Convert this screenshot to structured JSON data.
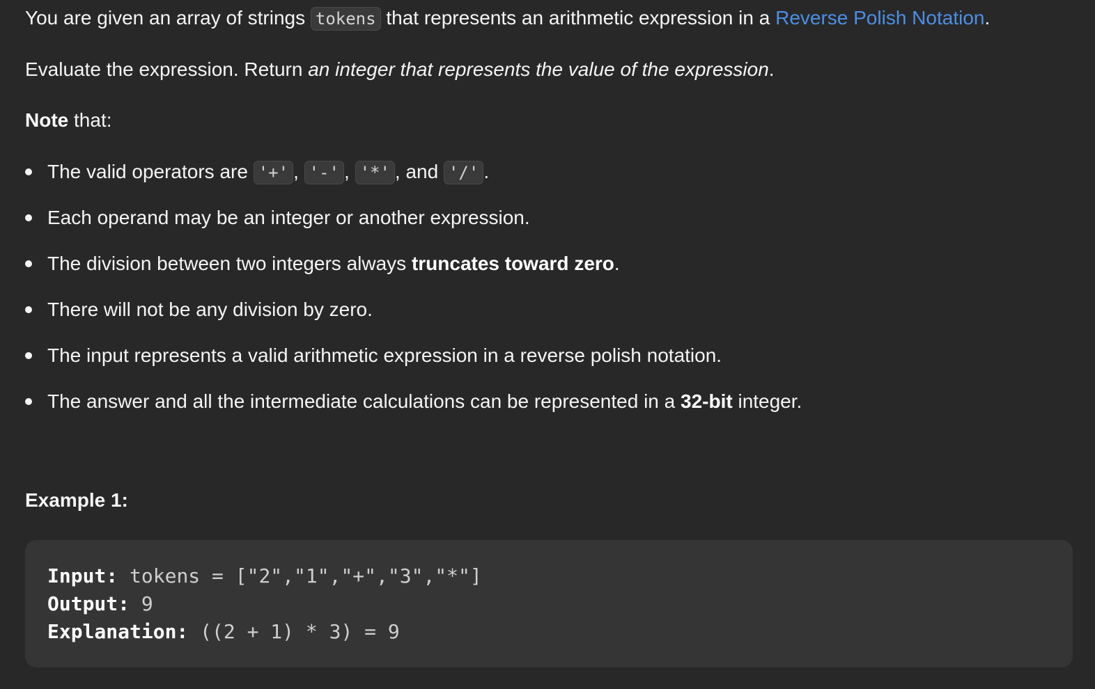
{
  "intro": {
    "before_code": "You are given an array of strings ",
    "code": "tokens",
    "after_code": " that represents an arithmetic expression in a ",
    "link": "Reverse Polish Notation",
    "end": "."
  },
  "evaluate": {
    "plain": "Evaluate the expression. Return ",
    "italic": "an integer that represents the value of the expression",
    "end": "."
  },
  "note": {
    "bold": "Note",
    "rest": " that:"
  },
  "bullets": {
    "operators": {
      "text": "The valid operators are ",
      "op1": "'+'",
      "sep1": ", ",
      "op2": "'-'",
      "sep2": ", ",
      "op3": "'*'",
      "sep3": ", and ",
      "op4": "'/'",
      "end": "."
    },
    "operand": "Each operand may be an integer or another expression.",
    "division": {
      "text": "The division between two integers always ",
      "bold": "truncates toward zero",
      "end": "."
    },
    "no_zero": "There will not be any division by zero.",
    "valid_input": "The input represents a valid arithmetic expression in a reverse polish notation.",
    "bits": {
      "text": "The answer and all the intermediate calculations can be represented in a ",
      "bold": "32-bit",
      "end": " integer."
    }
  },
  "example1": {
    "title": "Example 1:",
    "input_label": "Input:",
    "input_value": " tokens = [\"2\",\"1\",\"+\",\"3\",\"*\"]",
    "output_label": "Output:",
    "output_value": " 9",
    "explanation_label": "Explanation:",
    "explanation_value": " ((2 + 1) * 3) = 9"
  }
}
